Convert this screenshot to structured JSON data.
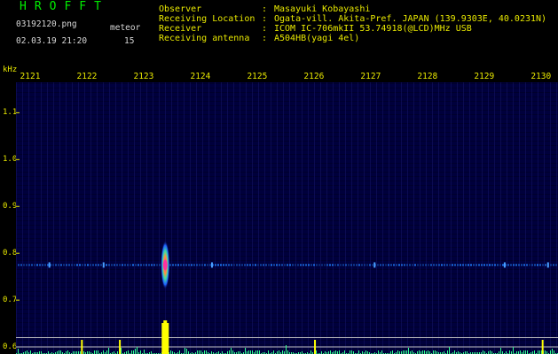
{
  "app_title": "HROFFT",
  "header": {
    "filename": "03192120.png",
    "meteor_label": "meteor",
    "datetime": "02.03.19 21:20",
    "meteor_count": "15"
  },
  "station_info": {
    "rows": [
      {
        "key": "Observer",
        "value": "Masayuki Kobayashi"
      },
      {
        "key": "Receiving Location",
        "value": "Ogata-vill. Akita-Pref. JAPAN (139.9303E, 40.0231N)"
      },
      {
        "key": "Receiver",
        "value": "ICOM IC-706mkII 53.74918(@LCD)MHz USB"
      },
      {
        "key": "Receiving antenna",
        "value": "A504HB(yagi 4el)"
      }
    ]
  },
  "freq_unit": "kHz",
  "chart_data": {
    "type": "heatmap",
    "title": "",
    "xlabel": "",
    "ylabel": "kHz",
    "x_ticks": [
      "2121",
      "2122",
      "2123",
      "2124",
      "2125",
      "2126",
      "2127",
      "2128",
      "2129",
      "2130"
    ],
    "y_ticks": [
      "1.1",
      "1.0",
      "0.9",
      "0.8",
      "0.7",
      "0.6"
    ],
    "xlim": [
      2120.75,
      2130.3
    ],
    "ylim": [
      0.585,
      1.165
    ],
    "carrier_frequency_khz": 0.775,
    "meteor_echo": {
      "time": 2123.38,
      "frequency_khz": 0.775,
      "echo_count": 1
    },
    "reference_lines_khz": [
      0.62,
      0.6
    ],
    "colors": {
      "background": "#00003c",
      "labels": "#e8e800",
      "title": "#00ee00",
      "carrier": "#1e7dff",
      "echo_core": "#ff30a0",
      "echo_burst": "#ffff00",
      "noise_floor": "#30ff90"
    }
  }
}
